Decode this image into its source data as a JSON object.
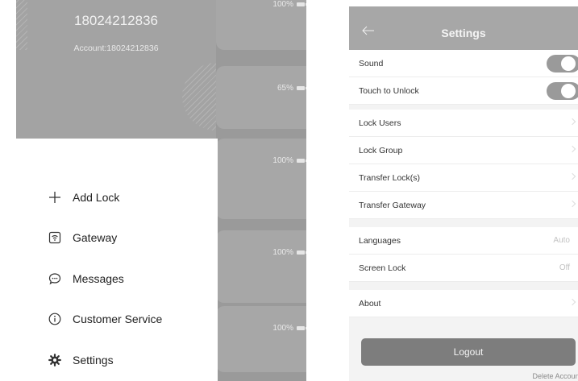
{
  "left_phone": {
    "user": {
      "phone_number": "18024212836",
      "account_text": "Account:18024212836"
    },
    "lock_cards": [
      {
        "battery": "100%"
      },
      {
        "battery": "65%"
      },
      {
        "battery": "100%"
      },
      {
        "battery": "100%"
      },
      {
        "battery": "100%"
      }
    ],
    "menu": [
      {
        "label": "Add Lock",
        "icon": "plus-icon"
      },
      {
        "label": "Gateway",
        "icon": "gateway-icon"
      },
      {
        "label": "Messages",
        "icon": "message-bubble-icon"
      },
      {
        "label": "Customer Service",
        "icon": "info-icon"
      },
      {
        "label": "Settings",
        "icon": "gear-icon"
      }
    ]
  },
  "right_phone": {
    "title": "Settings",
    "rows": {
      "sound": {
        "label": "Sound",
        "toggle_on": true
      },
      "touch_to_unlock": {
        "label": "Touch to Unlock",
        "toggle_on": true
      },
      "lock_users": {
        "label": "Lock Users"
      },
      "lock_group": {
        "label": "Lock Group"
      },
      "transfer_locks": {
        "label": "Transfer Lock(s)"
      },
      "transfer_gateway": {
        "label": "Transfer Gateway"
      },
      "languages": {
        "label": "Languages",
        "value": "Auto"
      },
      "screen_lock": {
        "label": "Screen Lock",
        "value": "Off"
      },
      "about": {
        "label": "About"
      }
    },
    "logout_label": "Logout",
    "delete_account_label": "Delete Account"
  }
}
